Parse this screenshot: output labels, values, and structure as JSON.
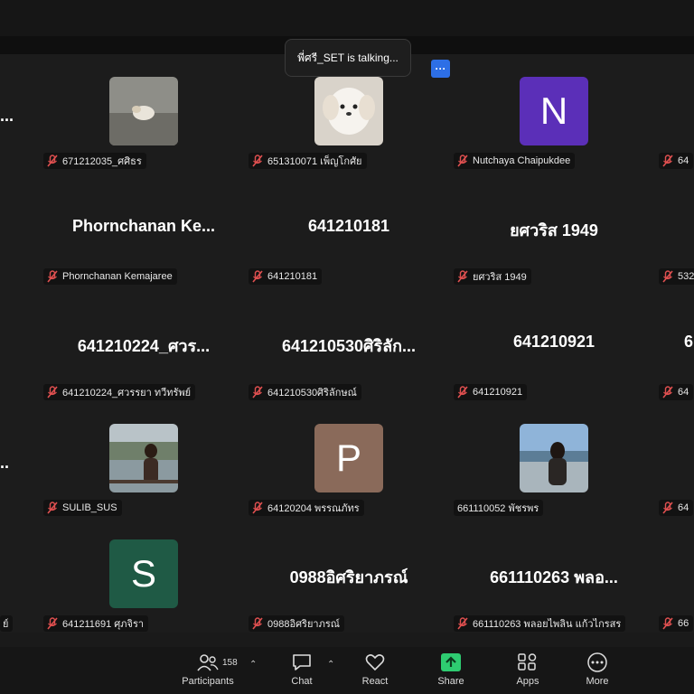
{
  "talking_indicator": "พี่ศรี_SET is talking...",
  "more_dots": "···",
  "tiles": [
    {
      "label": "671212035_ศศิธร"
    },
    {
      "label": "651310071 เพ็ญโกศัย"
    },
    {
      "initial": "N",
      "label": "Nutchaya Chaipukdee"
    },
    {
      "label": "64"
    },
    {
      "big": "Phornchanan  Ke...",
      "label": "Phornchanan Kemajaree"
    },
    {
      "big": "641210181",
      "label": "641210181"
    },
    {
      "big": "ยศวริส 1949",
      "label": "ยศวริส 1949"
    },
    {
      "label": "532"
    },
    {
      "big": "641210224_ศวร...",
      "label": "641210224_ศวรรยา ทวีทรัพย์"
    },
    {
      "big": "641210530ศิริลัก...",
      "label": "641210530ศิริลักษณ์"
    },
    {
      "big": "641210921",
      "label": "641210921"
    },
    {
      "big": "6",
      "label": "64"
    },
    {
      "label": "SULIB_SUS"
    },
    {
      "initial": "P",
      "label": "64120204 พรรณภัทร"
    },
    {
      "label": "661110052 พัชรพร"
    },
    {
      "label": "64"
    },
    {
      "initial": "S",
      "label": "641211691 ศุภจิรา"
    },
    {
      "big": "0988อิศริยาภรณ์",
      "label": "0988อิศริยาภรณ์"
    },
    {
      "big": "661110263 พลอ...",
      "label": "661110263 พลอยไพลิน แก้วไกรสร"
    },
    {
      "label": "66"
    },
    {
      "label": "ย์"
    }
  ],
  "left_dots": [
    "...",
    ".."
  ],
  "toolbar": {
    "participants_label": "Participants",
    "participants_count": "158",
    "chat_label": "Chat",
    "react_label": "React",
    "share_label": "Share",
    "apps_label": "Apps",
    "more_label": "More"
  },
  "colors": {
    "N": "#5b2fb8",
    "P": "#8a6a5a",
    "S": "#1f5a45",
    "share": "#2ecc71"
  }
}
